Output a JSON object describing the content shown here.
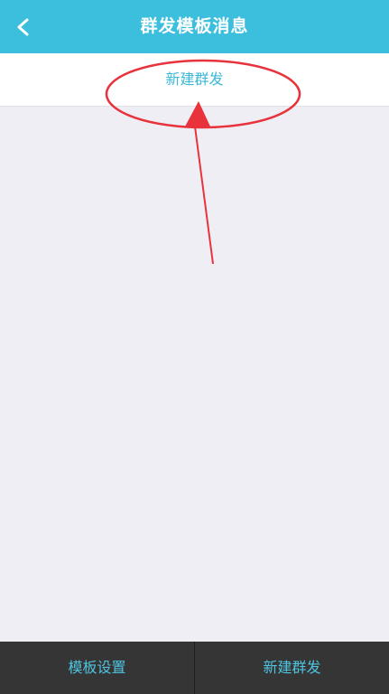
{
  "header": {
    "title": "群发模板消息",
    "back_icon": "chevron-left-icon"
  },
  "new_group_row": {
    "label": "新建群发"
  },
  "footer": {
    "template_settings_label": "模板设置",
    "new_group_send_label": "新建群发"
  },
  "colors": {
    "header_bg": "#3cbfdc",
    "accent_text": "#3cb8d6",
    "footer_bg": "#353535",
    "annotation_red": "#e8323c",
    "content_bg": "#efeef4"
  }
}
